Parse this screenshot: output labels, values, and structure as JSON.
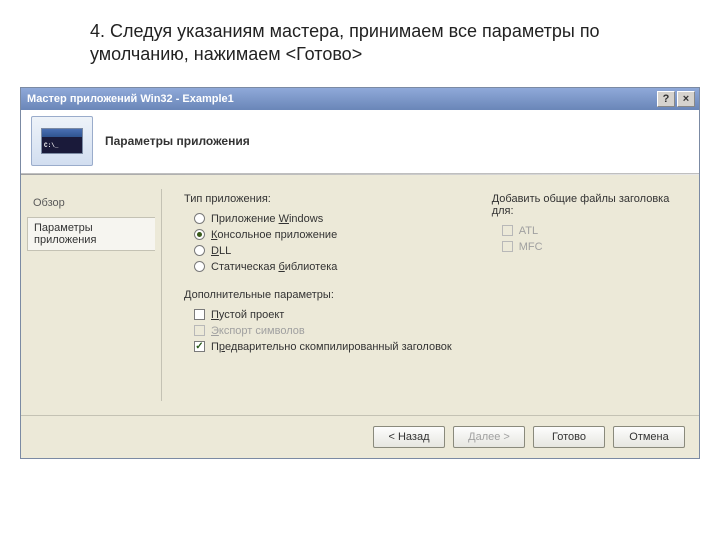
{
  "caption": "4. Следуя указаниям мастера, принимаем все параметры по умолчанию, нажимаем <Готово>",
  "titlebar": {
    "title": "Мастер приложений Win32 - Example1",
    "help": "?",
    "close": "×"
  },
  "banner": {
    "title": "Параметры приложения",
    "cmd_prompt": "C:\\_"
  },
  "sidebar": {
    "overview": "Обзор",
    "params": "Параметры приложения"
  },
  "apptype": {
    "label": "Тип приложения:",
    "windows": "Приложение Windows",
    "console": "Консольное приложение",
    "dll": "DLL",
    "static": "Статическая библиотека"
  },
  "extra": {
    "label": "Дополнительные параметры:",
    "empty": "Пустой проект",
    "export": "Экспорт символов",
    "precomp": "Предварительно скомпилированный заголовок"
  },
  "headers": {
    "label": "Добавить общие файлы заголовка для:",
    "atl": "ATL",
    "mfc": "MFC"
  },
  "buttons": {
    "back": "< Назад",
    "next": "Далее >",
    "finish": "Готово",
    "cancel": "Отмена"
  }
}
